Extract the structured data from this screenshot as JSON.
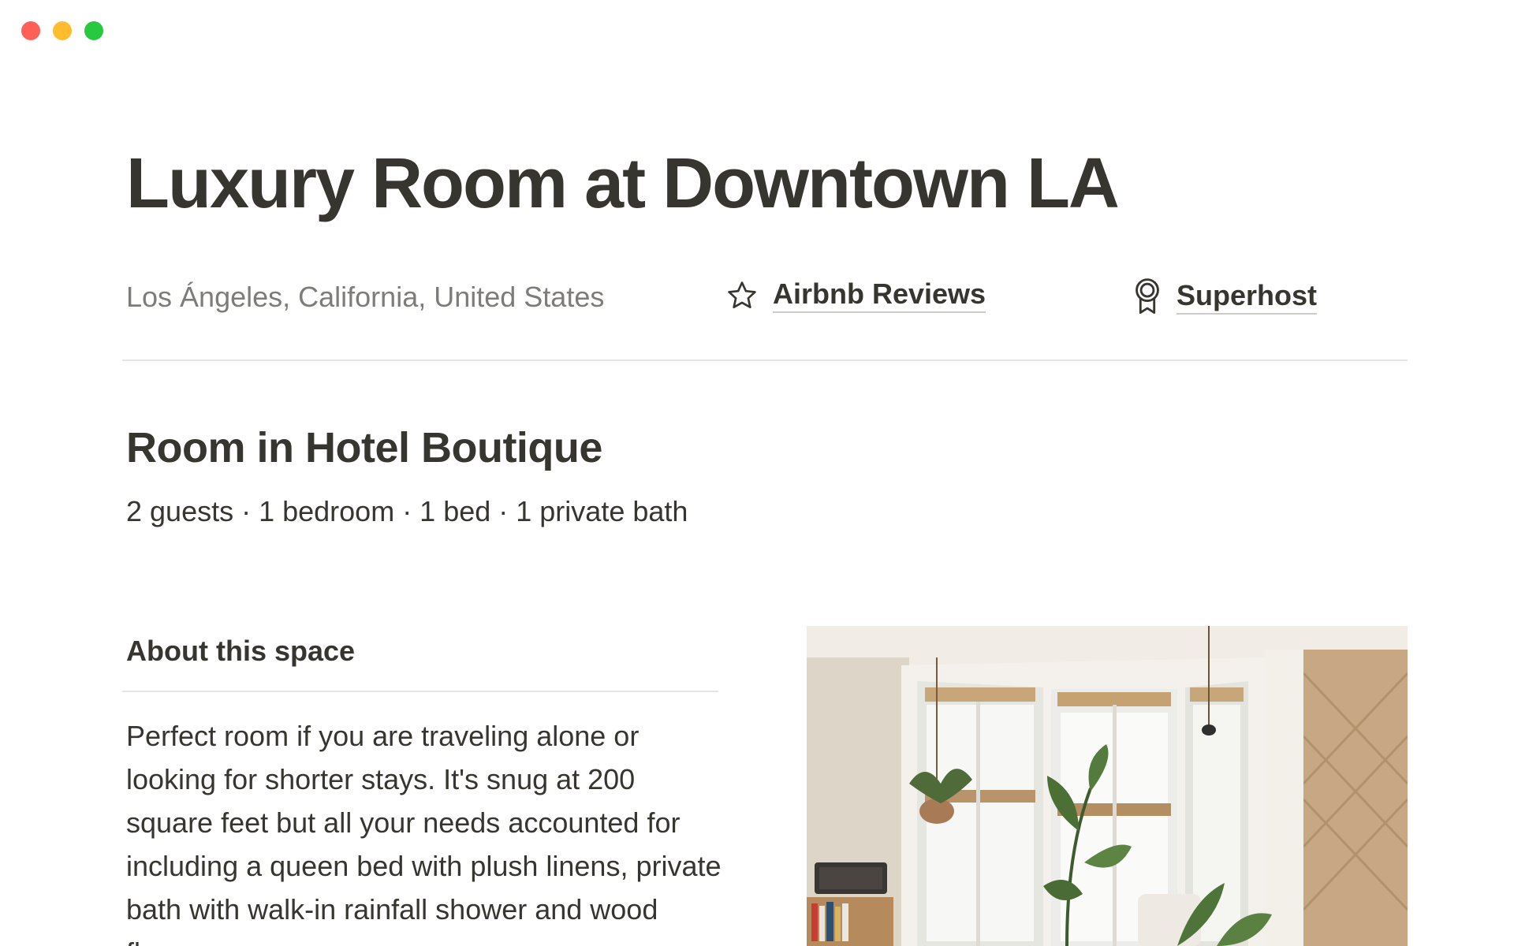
{
  "window": {
    "controls": {
      "close_color": "#ff5f57",
      "minimize_color": "#febc2e",
      "maximize_color": "#28c840"
    }
  },
  "page": {
    "title": "Luxury Room at Downtown LA",
    "location": "Los Ángeles, California, United States",
    "reviews_link": {
      "label": "Airbnb Reviews",
      "icon": "star-icon"
    },
    "superhost_link": {
      "label": "Superhost",
      "icon": "award-ribbon-icon"
    },
    "room_type": "Room in Hotel Boutique",
    "specs": "2 guests · 1 bedroom ·  1 bed · 1 private bath",
    "about": {
      "heading": "About this space",
      "description": "Perfect room if you are traveling alone or looking for shorter stays. It's snug at 200 square feet but all your needs accounted for including a queen bed with plush linens, private bath with walk-in rainfall shower and wood floors."
    },
    "photo": {
      "subject": "sunlit room with bay window, plants and bookshelf"
    }
  }
}
